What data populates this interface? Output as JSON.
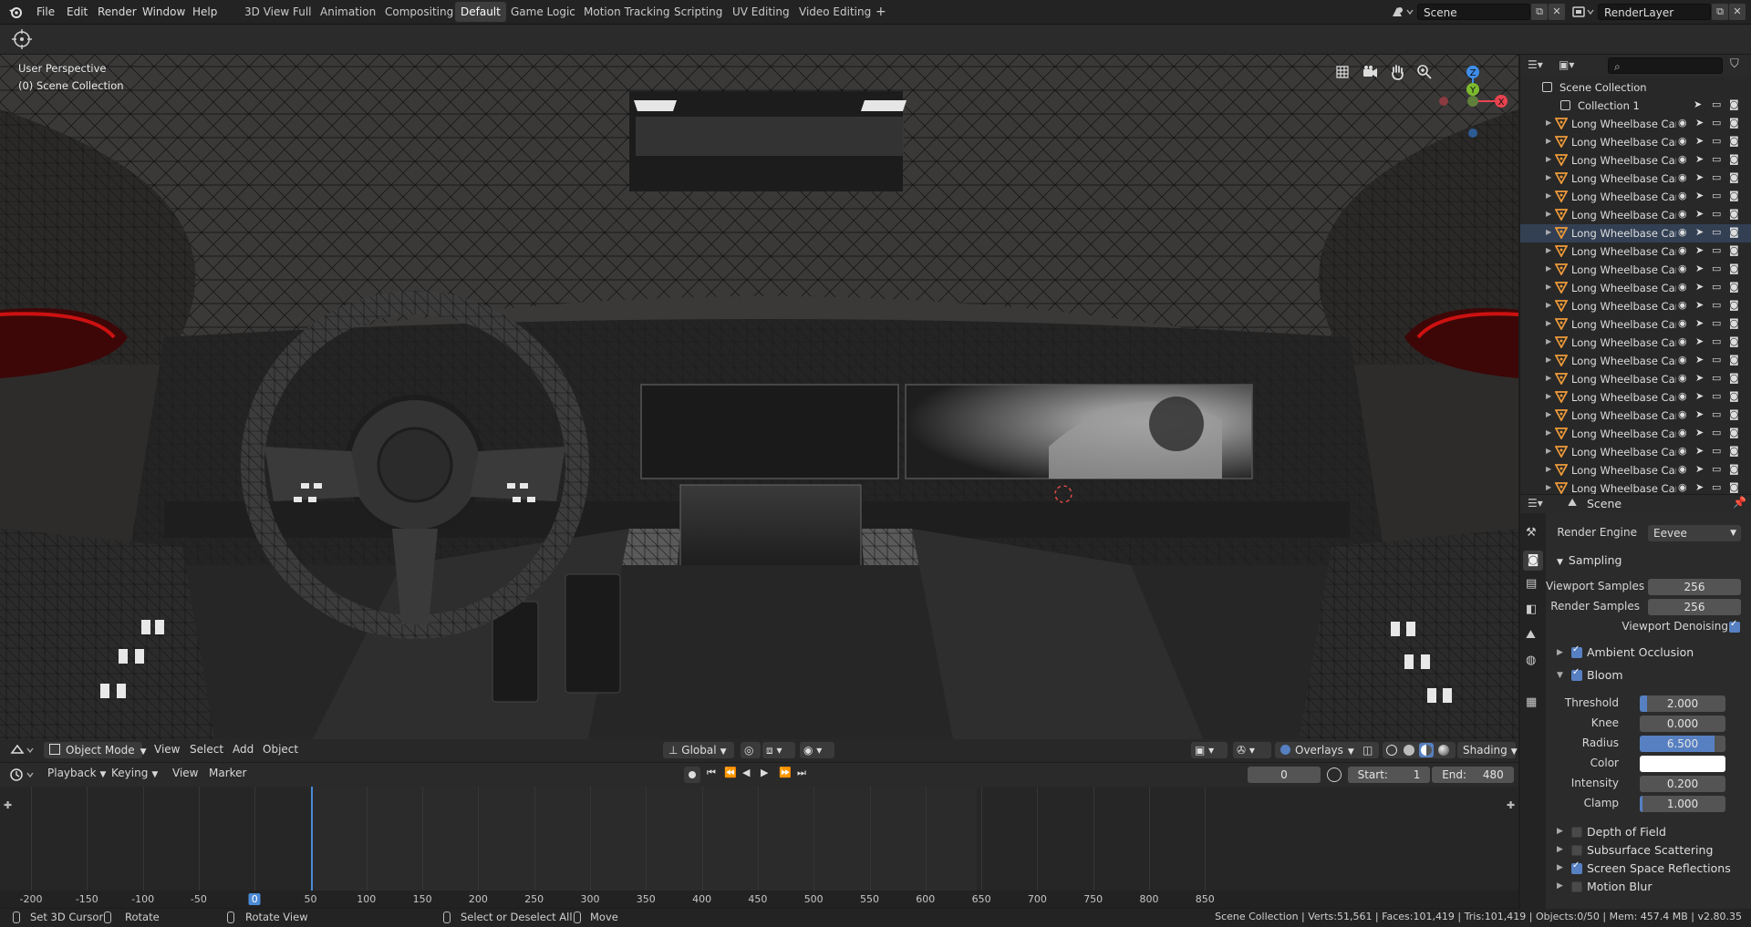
{
  "menu": {
    "items": [
      "File",
      "Edit",
      "Render",
      "Window",
      "Help"
    ]
  },
  "workspaces": {
    "tabs": [
      "3D View Full",
      "Animation",
      "Compositing",
      "Default",
      "Game Logic",
      "Motion Tracking",
      "Scripting",
      "UV Editing",
      "Video Editing"
    ],
    "active": "Default",
    "add_label": "+"
  },
  "scene": {
    "name": "Scene"
  },
  "render_layer": {
    "name": "RenderLayer"
  },
  "viewport": {
    "perspective": "User Perspective",
    "collection": "(0) Scene Collection",
    "mode": "Object Mode",
    "menus": [
      "View",
      "Select",
      "Add",
      "Object"
    ],
    "orientation": "Global",
    "overlays_label": "Overlays",
    "shading_label": "Shading",
    "gizmo_axes": {
      "x": "X",
      "y": "Y",
      "z": "Z"
    }
  },
  "timeline": {
    "menus": [
      "Playback",
      "Keying",
      "View",
      "Marker"
    ],
    "current_frame": "0",
    "start_label": "Start:",
    "start": "1",
    "end_label": "End:",
    "end": "480",
    "ticks": [
      "-200",
      "-150",
      "-100",
      "-50",
      "0",
      "50",
      "100",
      "150",
      "200",
      "250",
      "300",
      "350",
      "400",
      "450",
      "500",
      "550",
      "600",
      "650",
      "700",
      "750",
      "800",
      "850"
    ]
  },
  "statusbar": {
    "items": [
      "Set 3D Cursor",
      "Rotate",
      "Rotate View",
      "Select or Deselect All",
      "Move"
    ],
    "stats": "Scene Collection | Verts:51,561 | Faces:101,419 | Tris:101,419 | Objects:0/50 | Mem: 457.4 MB | v2.80.35"
  },
  "outliner": {
    "root": "Scene Collection",
    "collection": "Collection 1",
    "object_name": "Long Wheelbase Car",
    "object_count": 21,
    "selected_index": 6
  },
  "properties": {
    "context": "Scene",
    "render_engine_label": "Render Engine",
    "render_engine": "Eevee",
    "sampling": {
      "title": "Sampling",
      "viewport_samples_label": "Viewport Samples",
      "viewport_samples": "256",
      "render_samples_label": "Render Samples",
      "render_samples": "256",
      "denoise_label": "Viewport Denoising"
    },
    "ambient_occlusion": "Ambient Occlusion",
    "bloom": {
      "title": "Bloom",
      "threshold_label": "Threshold",
      "threshold": "2.000",
      "threshold_fill": 0.08,
      "knee_label": "Knee",
      "knee": "0.000",
      "radius_label": "Radius",
      "radius": "6.500",
      "radius_fill": 0.87,
      "color_label": "Color",
      "intensity_label": "Intensity",
      "intensity": "0.200",
      "clamp_label": "Clamp",
      "clamp": "1.000",
      "clamp_fill": 0.03
    },
    "panels_after": [
      {
        "label": "Depth of Field",
        "checked": false
      },
      {
        "label": "Subsurface Scattering",
        "checked": false
      },
      {
        "label": "Screen Space Reflections",
        "checked": true
      },
      {
        "label": "Motion Blur",
        "checked": false
      }
    ]
  },
  "colors": {
    "accent": "#5680c2",
    "selection": "#334054",
    "axis_x": "#e8434f",
    "axis_y": "#7cba2e",
    "axis_z": "#3e8eea",
    "playhead": "#4b8ad6",
    "mesh_icon": "#ee9b3a"
  }
}
